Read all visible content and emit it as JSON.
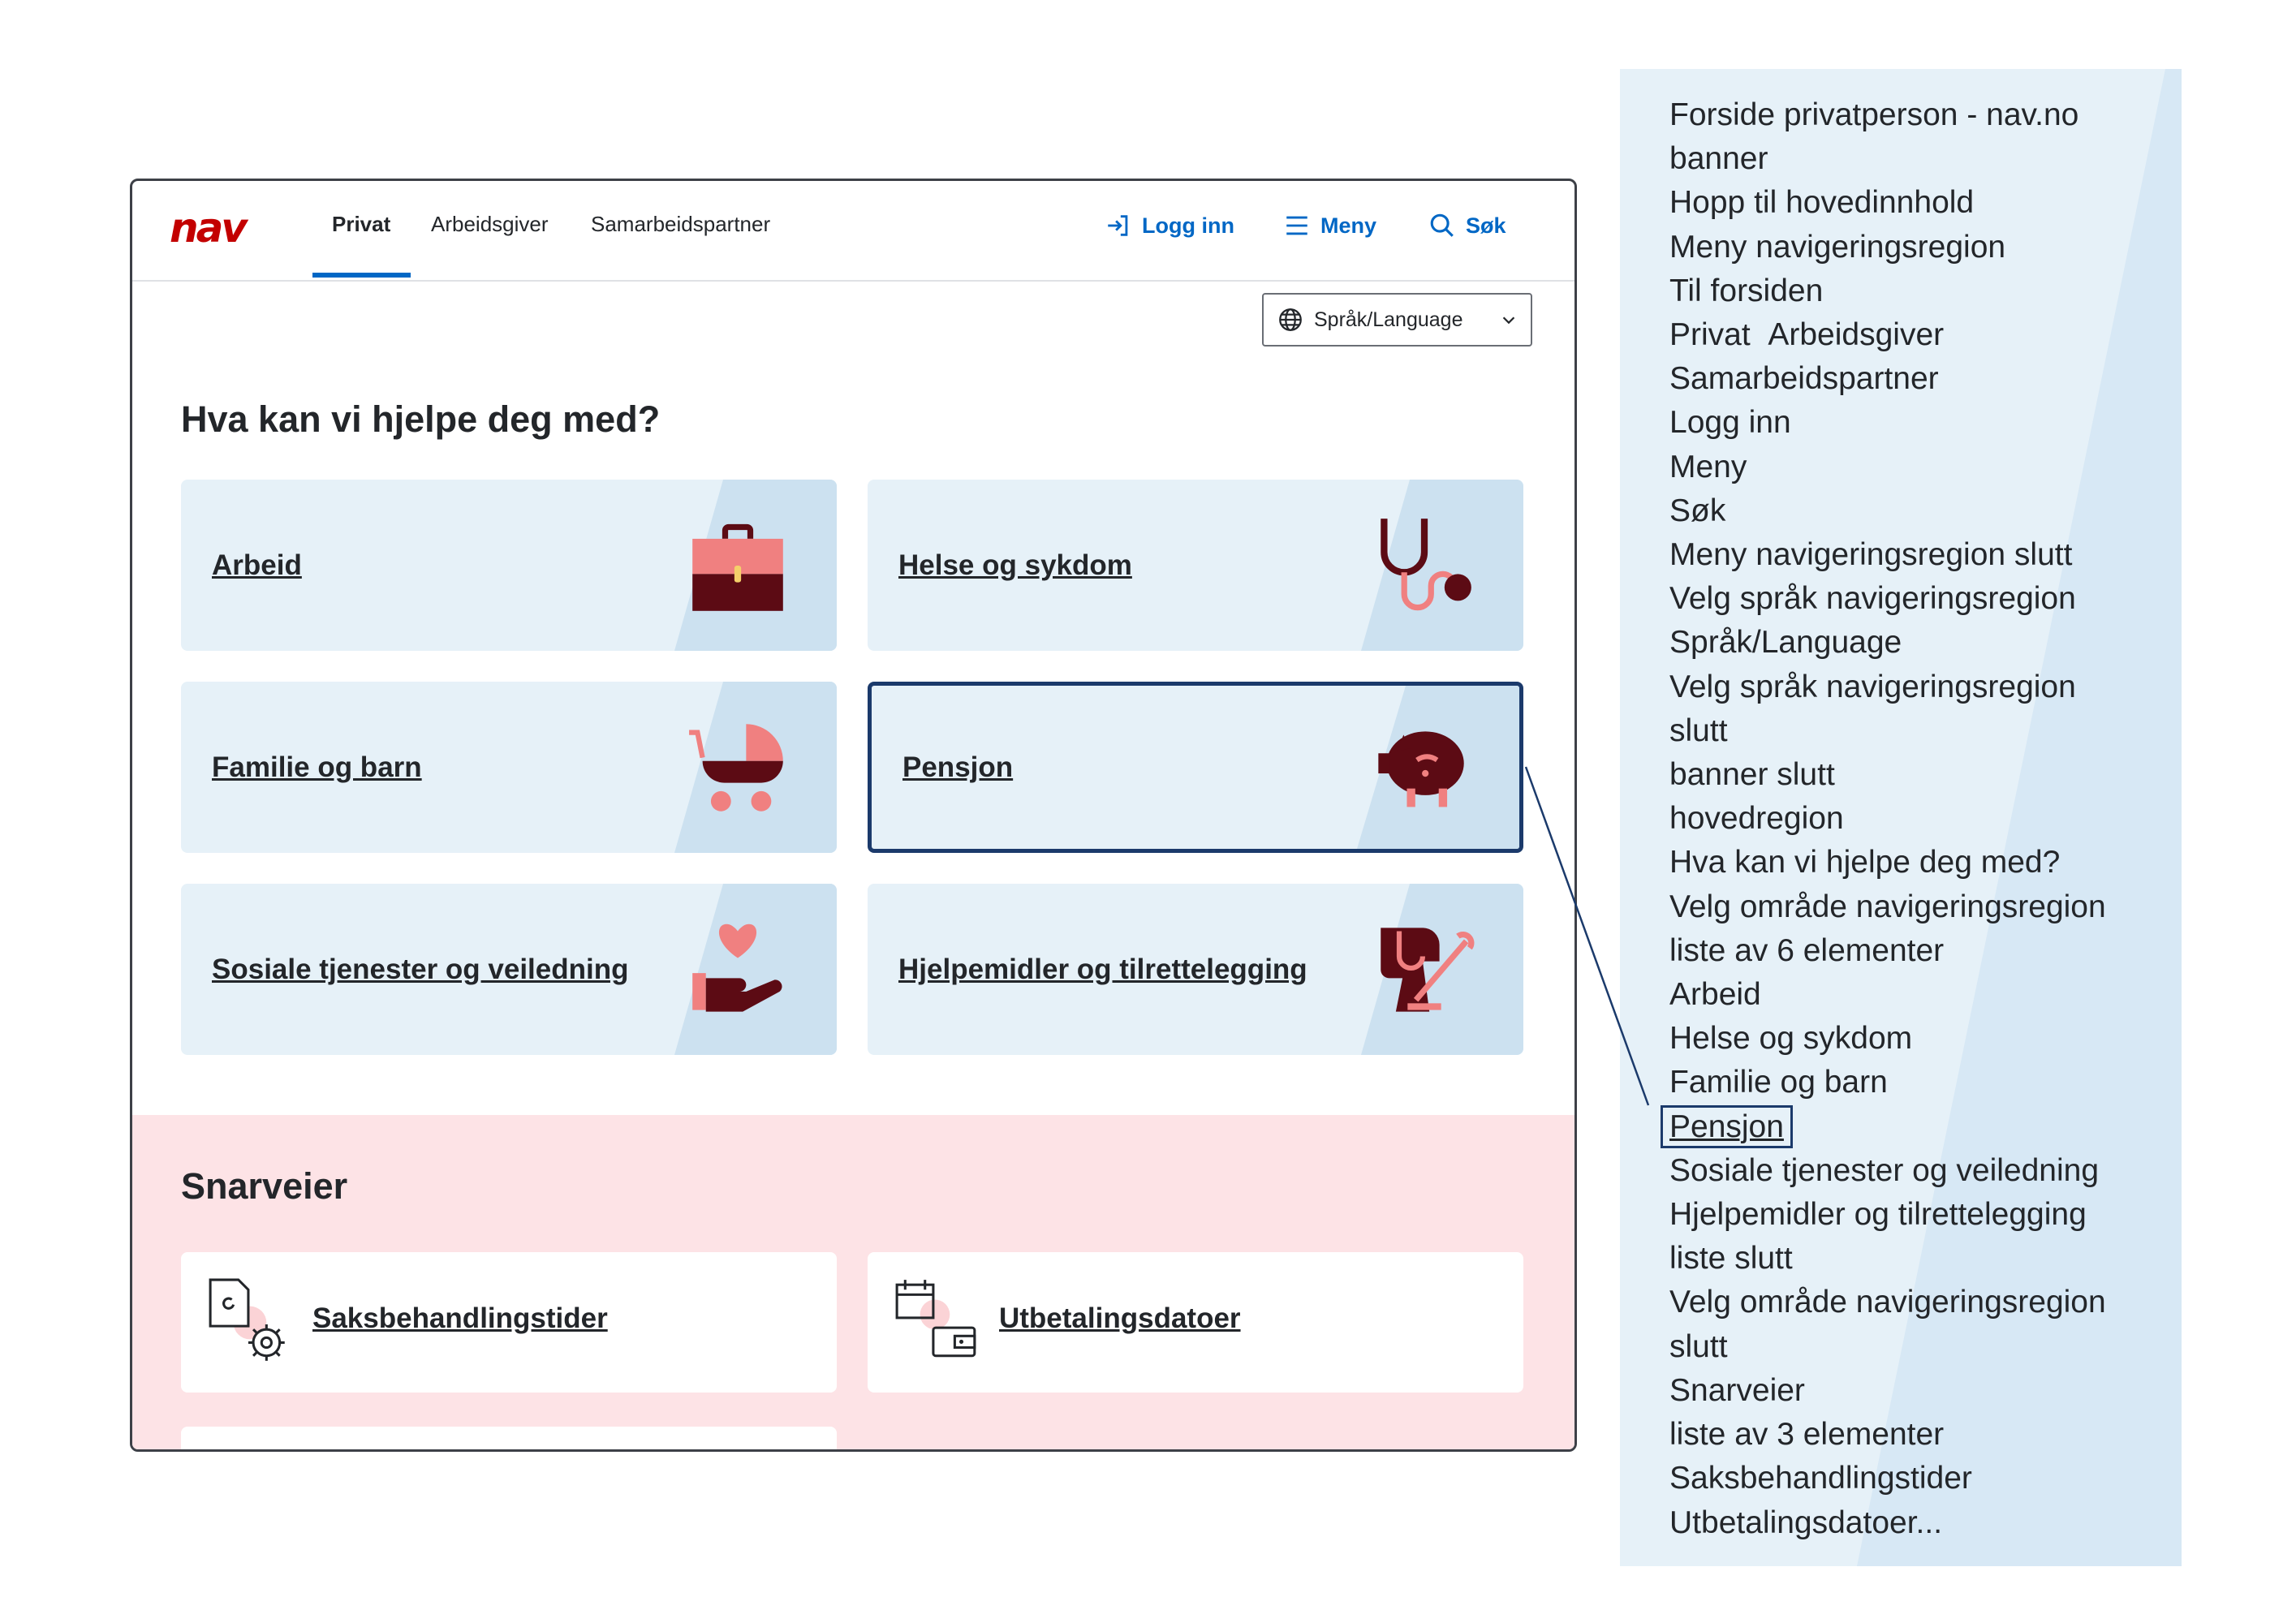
{
  "header": {
    "logo": "nav",
    "tabs": [
      {
        "label": "Privat",
        "active": true
      },
      {
        "label": "Arbeidsgiver",
        "active": false
      },
      {
        "label": "Samarbeidspartner",
        "active": false
      }
    ],
    "login": "Logg inn",
    "menu": "Meny",
    "search": "Søk"
  },
  "language": {
    "label": "Språk/Language",
    "icon": "globe-icon"
  },
  "help": {
    "heading": "Hva kan vi hjelpe deg med?",
    "cards": [
      {
        "label": "Arbeid",
        "icon": "briefcase-icon"
      },
      {
        "label": "Helse og sykdom",
        "icon": "stethoscope-icon"
      },
      {
        "label": "Familie og barn",
        "icon": "stroller-icon"
      },
      {
        "label": "Pensjon",
        "icon": "piggy-bank-icon",
        "selected": true
      },
      {
        "label": "Sosiale tjenester og veiledning",
        "icon": "hand-heart-icon"
      },
      {
        "label": "Hjelpemidler og tilrettelegging",
        "icon": "guide-dog-icon"
      }
    ]
  },
  "shortcuts": {
    "heading": "Snarveier",
    "items": [
      {
        "label": "Saksbehandlingstider",
        "icon": "document-gear-icon"
      },
      {
        "label": "Utbetalingsdatoer",
        "icon": "calendar-wallet-icon"
      }
    ]
  },
  "screen_reader": {
    "lines": [
      "Forside privatperson - nav.no",
      "banner",
      "Hopp til hovedinnhold",
      "Meny navigeringsregion",
      "Til forsiden",
      "Privat  Arbeidsgiver",
      "Samarbeidspartner",
      "Logg inn",
      "Meny",
      "Søk",
      "Meny navigeringsregion slutt",
      "Velg språk navigeringsregion",
      "Språk/Language",
      "Velg språk navigeringsregion",
      "slutt",
      "banner slutt",
      "hovedregion",
      "Hva kan vi hjelpe deg med?",
      "Velg område navigeringsregion",
      "liste av 6 elementer",
      "Arbeid",
      "Helse og sykdom",
      "Familie og barn",
      "Pensjon",
      "Sosiale tjenester og veiledning",
      "Hjelpemidler og tilrettelegging",
      "liste slutt",
      "Velg område navigeringsregion",
      "slutt",
      "Snarveier",
      "liste av 3 elementer",
      "Saksbehandlingstider",
      "Utbetalingsdatoer..."
    ],
    "focused_index": 23
  },
  "colors": {
    "brand": "#c30000",
    "link": "#0067c5",
    "card_bg": "#e6f1f8",
    "card_shade": "#cce1f0",
    "focus": "#1b3a6b",
    "shortcut_bg": "#fde3e6",
    "icon_dark": "#5c0b14",
    "icon_light": "#f08080"
  }
}
